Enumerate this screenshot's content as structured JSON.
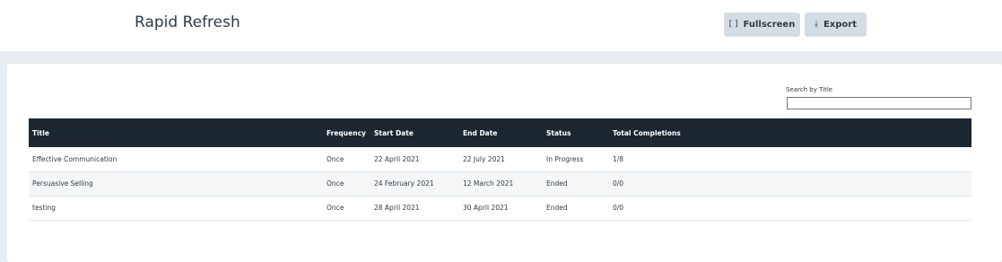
{
  "header": {
    "title": "Rapid Refresh",
    "fullscreen_label": "Fullscreen",
    "fullscreen_icon": "fullscreen-icon",
    "export_label": "Export",
    "export_icon": "download-icon"
  },
  "search": {
    "label": "Search by Title",
    "value": "",
    "placeholder": ""
  },
  "table": {
    "columns": [
      "Title",
      "Frequency",
      "Start Date",
      "End Date",
      "Status",
      "Total Completions"
    ],
    "rows": [
      [
        "Effective Communication",
        "Once",
        "22 April 2021",
        "22 July 2021",
        "In Progress",
        "1/8"
      ],
      [
        "Persuasive Selling",
        "Once",
        "24 February 2021",
        "12 March 2021",
        "Ended",
        "0/0"
      ],
      [
        "testing",
        "Once",
        "28 April 2021",
        "30 April 2021",
        "Ended",
        "0/0"
      ]
    ]
  },
  "colors": {
    "header_bg": "#1d2731",
    "button_bg": "#d5dde4",
    "page_bg": "#e8edf1"
  }
}
